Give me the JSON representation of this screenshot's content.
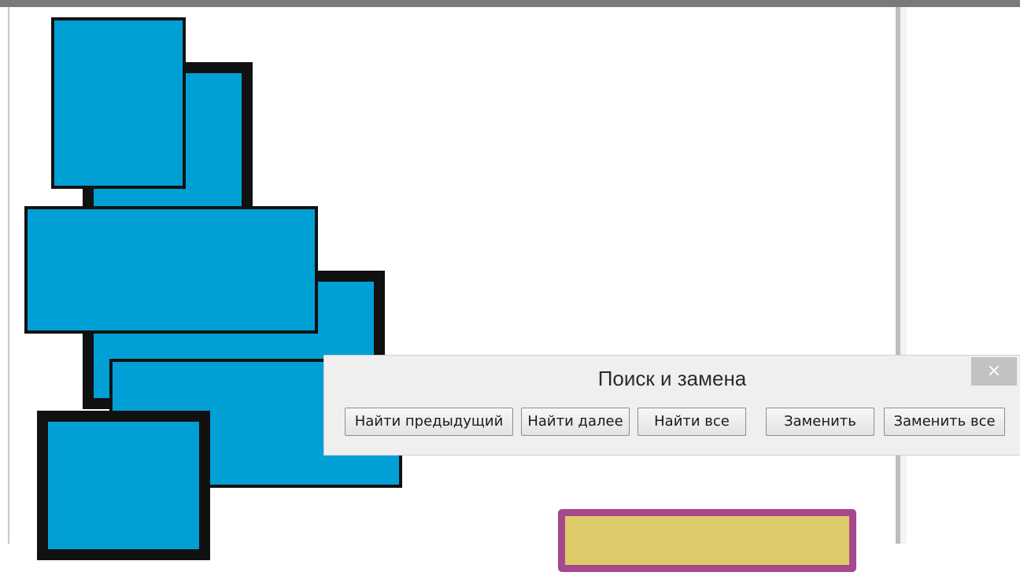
{
  "dialog": {
    "title": "Поиск и замена",
    "close_label": "×",
    "buttons": {
      "find_previous": "Найти предыдущий",
      "find_next": "Найти далее",
      "find_all": "Найти все",
      "replace": "Заменить",
      "replace_all": "Заменить все"
    }
  },
  "colors": {
    "shape_fill": "#00a0d6",
    "shape_outline": "#111111",
    "yellow_fill": "#dccb68",
    "magenta_outline": "#a7488f",
    "dialog_background": "#efefef"
  }
}
